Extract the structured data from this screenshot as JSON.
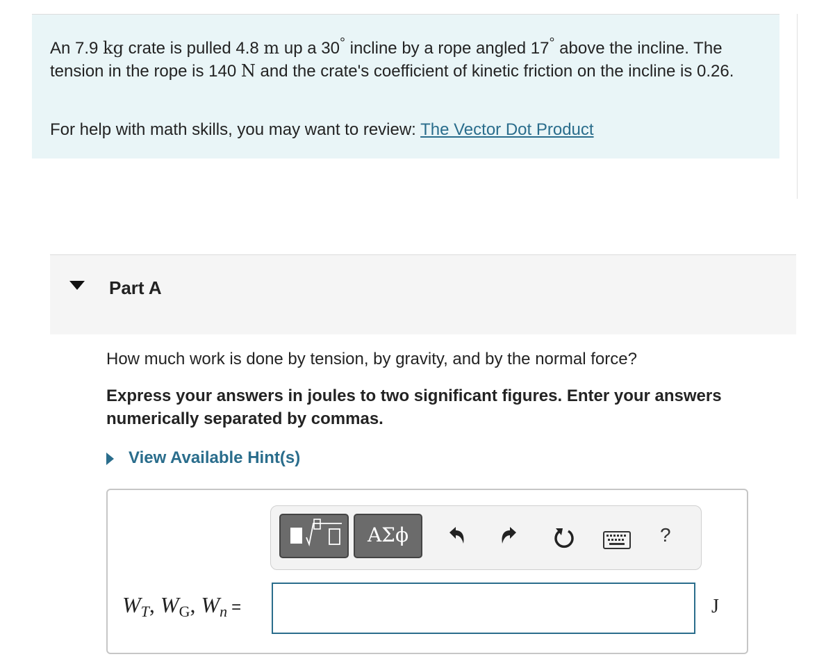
{
  "problem": {
    "mass_value": "An 7.9 ",
    "mass_unit": "kg",
    "text_a": " crate is pulled 4.8 ",
    "dist_unit": "m",
    "text_b": " up a 30",
    "deg1": "°",
    "text_c": " incline by a rope angled 17",
    "deg2": "°",
    "text_d": " above the incline. The tension in the rope is 140 ",
    "force_unit": "N",
    "text_e": " and the crate's coefficient of kinetic friction on the incline is 0.26."
  },
  "help": {
    "prefix": "For help with math skills, you may want to review: ",
    "link_label": "The Vector Dot Product"
  },
  "part": {
    "title": "Part A"
  },
  "question": "How much work is done by tension, by gravity, and by the normal force?",
  "instruction": "Express your answers in joules to two significant figures. Enter your answers numerically separated by commas.",
  "hint": {
    "label": "View Available Hint(s)"
  },
  "toolbar": {
    "symbols_label": "ΑΣϕ",
    "help_label": "?",
    "icons": [
      "templates-icon",
      "undo-icon",
      "redo-icon",
      "reset-icon",
      "keyboard-icon",
      "help-icon"
    ]
  },
  "answer": {
    "label_w1": "W",
    "label_s1": "T",
    "label_sep1": ", ",
    "label_w2": "W",
    "label_s2": "G",
    "label_sep2": ", ",
    "label_w3": "W",
    "label_s3": "n",
    "label_eq": "=",
    "value": "",
    "unit": "J"
  },
  "colors": {
    "accent": "#2a6d8c",
    "intro_bg": "#e9f5f7",
    "part_bg": "#f5f5f5"
  }
}
